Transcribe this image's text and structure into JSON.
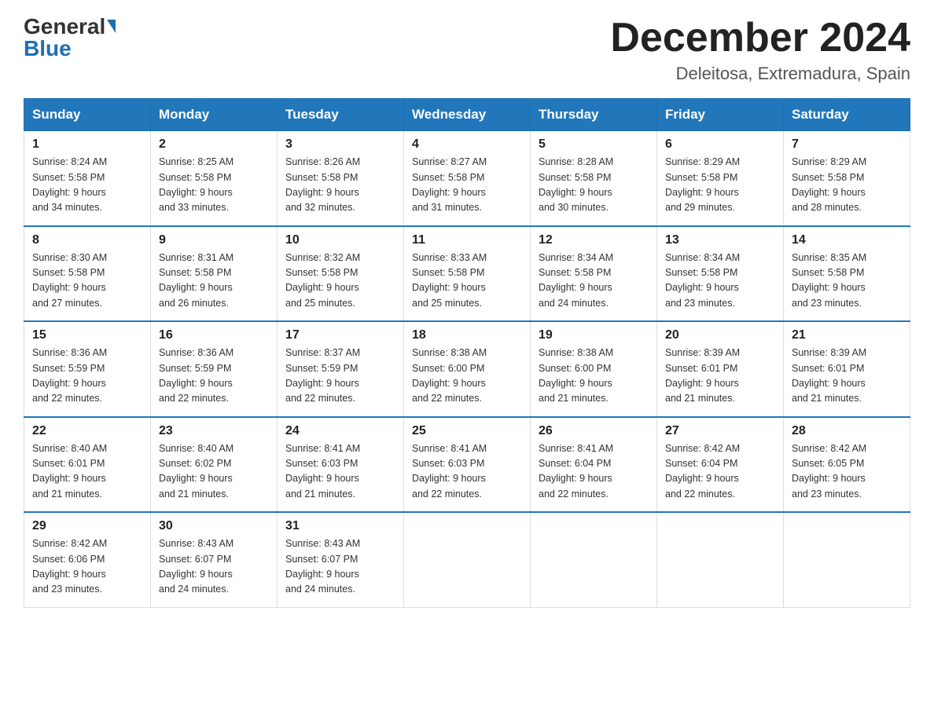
{
  "header": {
    "logo_general": "General",
    "logo_blue": "Blue",
    "title": "December 2024",
    "subtitle": "Deleitosa, Extremadura, Spain"
  },
  "days_of_week": [
    "Sunday",
    "Monday",
    "Tuesday",
    "Wednesday",
    "Thursday",
    "Friday",
    "Saturday"
  ],
  "weeks": [
    [
      {
        "day": "1",
        "sunrise": "8:24 AM",
        "sunset": "5:58 PM",
        "daylight": "9 hours and 34 minutes."
      },
      {
        "day": "2",
        "sunrise": "8:25 AM",
        "sunset": "5:58 PM",
        "daylight": "9 hours and 33 minutes."
      },
      {
        "day": "3",
        "sunrise": "8:26 AM",
        "sunset": "5:58 PM",
        "daylight": "9 hours and 32 minutes."
      },
      {
        "day": "4",
        "sunrise": "8:27 AM",
        "sunset": "5:58 PM",
        "daylight": "9 hours and 31 minutes."
      },
      {
        "day": "5",
        "sunrise": "8:28 AM",
        "sunset": "5:58 PM",
        "daylight": "9 hours and 30 minutes."
      },
      {
        "day": "6",
        "sunrise": "8:29 AM",
        "sunset": "5:58 PM",
        "daylight": "9 hours and 29 minutes."
      },
      {
        "day": "7",
        "sunrise": "8:29 AM",
        "sunset": "5:58 PM",
        "daylight": "9 hours and 28 minutes."
      }
    ],
    [
      {
        "day": "8",
        "sunrise": "8:30 AM",
        "sunset": "5:58 PM",
        "daylight": "9 hours and 27 minutes."
      },
      {
        "day": "9",
        "sunrise": "8:31 AM",
        "sunset": "5:58 PM",
        "daylight": "9 hours and 26 minutes."
      },
      {
        "day": "10",
        "sunrise": "8:32 AM",
        "sunset": "5:58 PM",
        "daylight": "9 hours and 25 minutes."
      },
      {
        "day": "11",
        "sunrise": "8:33 AM",
        "sunset": "5:58 PM",
        "daylight": "9 hours and 25 minutes."
      },
      {
        "day": "12",
        "sunrise": "8:34 AM",
        "sunset": "5:58 PM",
        "daylight": "9 hours and 24 minutes."
      },
      {
        "day": "13",
        "sunrise": "8:34 AM",
        "sunset": "5:58 PM",
        "daylight": "9 hours and 23 minutes."
      },
      {
        "day": "14",
        "sunrise": "8:35 AM",
        "sunset": "5:58 PM",
        "daylight": "9 hours and 23 minutes."
      }
    ],
    [
      {
        "day": "15",
        "sunrise": "8:36 AM",
        "sunset": "5:59 PM",
        "daylight": "9 hours and 22 minutes."
      },
      {
        "day": "16",
        "sunrise": "8:36 AM",
        "sunset": "5:59 PM",
        "daylight": "9 hours and 22 minutes."
      },
      {
        "day": "17",
        "sunrise": "8:37 AM",
        "sunset": "5:59 PM",
        "daylight": "9 hours and 22 minutes."
      },
      {
        "day": "18",
        "sunrise": "8:38 AM",
        "sunset": "6:00 PM",
        "daylight": "9 hours and 22 minutes."
      },
      {
        "day": "19",
        "sunrise": "8:38 AM",
        "sunset": "6:00 PM",
        "daylight": "9 hours and 21 minutes."
      },
      {
        "day": "20",
        "sunrise": "8:39 AM",
        "sunset": "6:01 PM",
        "daylight": "9 hours and 21 minutes."
      },
      {
        "day": "21",
        "sunrise": "8:39 AM",
        "sunset": "6:01 PM",
        "daylight": "9 hours and 21 minutes."
      }
    ],
    [
      {
        "day": "22",
        "sunrise": "8:40 AM",
        "sunset": "6:01 PM",
        "daylight": "9 hours and 21 minutes."
      },
      {
        "day": "23",
        "sunrise": "8:40 AM",
        "sunset": "6:02 PM",
        "daylight": "9 hours and 21 minutes."
      },
      {
        "day": "24",
        "sunrise": "8:41 AM",
        "sunset": "6:03 PM",
        "daylight": "9 hours and 21 minutes."
      },
      {
        "day": "25",
        "sunrise": "8:41 AM",
        "sunset": "6:03 PM",
        "daylight": "9 hours and 22 minutes."
      },
      {
        "day": "26",
        "sunrise": "8:41 AM",
        "sunset": "6:04 PM",
        "daylight": "9 hours and 22 minutes."
      },
      {
        "day": "27",
        "sunrise": "8:42 AM",
        "sunset": "6:04 PM",
        "daylight": "9 hours and 22 minutes."
      },
      {
        "day": "28",
        "sunrise": "8:42 AM",
        "sunset": "6:05 PM",
        "daylight": "9 hours and 23 minutes."
      }
    ],
    [
      {
        "day": "29",
        "sunrise": "8:42 AM",
        "sunset": "6:06 PM",
        "daylight": "9 hours and 23 minutes."
      },
      {
        "day": "30",
        "sunrise": "8:43 AM",
        "sunset": "6:07 PM",
        "daylight": "9 hours and 24 minutes."
      },
      {
        "day": "31",
        "sunrise": "8:43 AM",
        "sunset": "6:07 PM",
        "daylight": "9 hours and 24 minutes."
      },
      null,
      null,
      null,
      null
    ]
  ],
  "labels": {
    "sunrise": "Sunrise:",
    "sunset": "Sunset:",
    "daylight": "Daylight:"
  }
}
